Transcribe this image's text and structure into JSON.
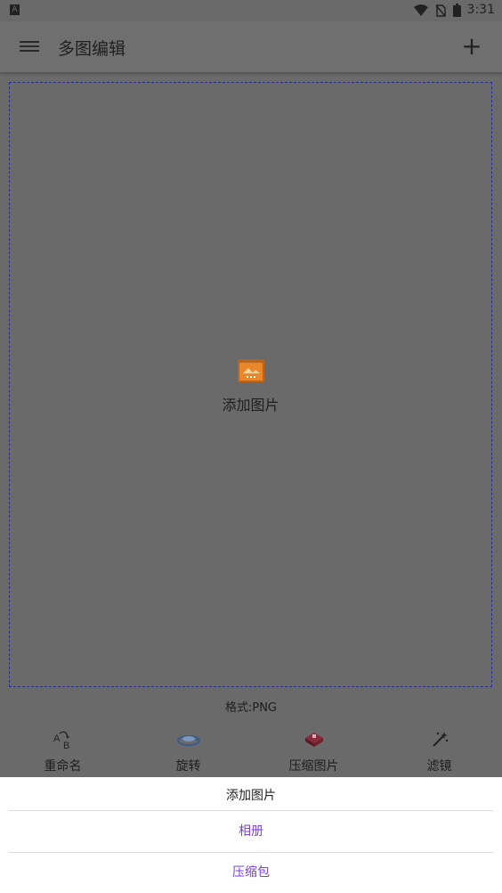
{
  "status_bar": {
    "time": "3:31",
    "app_badge": "A"
  },
  "app_bar": {
    "title": "多图编辑",
    "add_symbol": "+"
  },
  "dropzone": {
    "label": "添加图片"
  },
  "format_label": "格式:PNG",
  "toolbar": [
    {
      "label": "重命名",
      "icon": "rename-icon"
    },
    {
      "label": "旋转",
      "icon": "rotate-icon"
    },
    {
      "label": "压缩图片",
      "icon": "compress-image-icon"
    },
    {
      "label": "滤镜",
      "icon": "filter-icon"
    }
  ],
  "sheet": {
    "title": "添加图片",
    "options": [
      "相册",
      "压缩包"
    ],
    "accent_color": "#7b3fe0"
  }
}
